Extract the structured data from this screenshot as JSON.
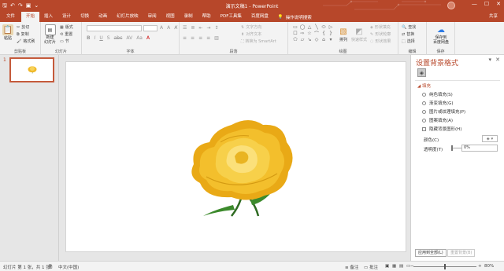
{
  "titlebar": {
    "title": "演示文稿1 - PowerPoint",
    "qat_icons": [
      "save-icon",
      "undo-icon",
      "redo-icon",
      "present-icon",
      "customize-icon"
    ],
    "qat_glyphs": [
      "🖫",
      "↶",
      "↷",
      "▣",
      "⌄"
    ],
    "window_controls": [
      "—",
      "☐",
      "✕"
    ],
    "colors": {
      "accent": "#b7472a"
    }
  },
  "tabs": {
    "items": [
      "文件",
      "开始",
      "插入",
      "设计",
      "切换",
      "动画",
      "幻灯片放映",
      "审阅",
      "视图",
      "录制",
      "帮助",
      "PDF工具集",
      "百度网盘"
    ],
    "active_index": 1,
    "tell_me": "操作说明搜索",
    "share": "共享"
  },
  "ribbon": {
    "clipboard": {
      "paste": "粘贴",
      "cut": "剪切",
      "copy": "复制",
      "format_painter": "格式刷",
      "group": "剪贴板"
    },
    "slides": {
      "new_slide": "新建\n幻灯片",
      "layout": "版式",
      "reset": "重置",
      "section": "节",
      "group": "幻灯片"
    },
    "font": {
      "group": "字体"
    },
    "paragraph": {
      "text_direction": "文字方向",
      "align_text": "对齐文本",
      "smartart": "转换为 SmartArt",
      "group": "段落"
    },
    "drawing": {
      "arrange": "排列",
      "quick_styles": "快速样式",
      "shape_fill": "形状填充",
      "shape_outline": "形状轮廓",
      "shape_effects": "形状效果",
      "group": "绘图",
      "shape_glyphs": [
        "▭",
        "◯",
        "△",
        "╲",
        "⬭",
        "▷",
        "☐",
        "⇨",
        "☆",
        "⌒",
        "{",
        "}",
        "⬠",
        "▱",
        "↘",
        "◇",
        "⌂",
        "▾"
      ]
    },
    "editing": {
      "find": "查找",
      "replace": "替换",
      "select": "选择",
      "group": "编辑"
    },
    "baidu": {
      "save": "保存到\n百度网盘",
      "group": "保存"
    }
  },
  "thumbnails": {
    "slide_number": "1"
  },
  "format_pane": {
    "title": "设置背景格式",
    "section": "填充",
    "options": [
      "纯色填充(S)",
      "渐变填充(G)",
      "图片或纹理填充(P)",
      "图案填充(A)"
    ],
    "hide_graphics": "隐藏背景图形(H)",
    "color_label": "颜色(C)",
    "transparency_label": "透明度(T)",
    "transparency_value": "0%",
    "apply_all": "应用到全部(L)",
    "reset": "重置背景(B)"
  },
  "statusbar": {
    "slide_info": "幻灯片 第 1 张，共 1 张",
    "language": "中文(中国)",
    "notes": "备注",
    "comments": "批注",
    "zoom": "80%"
  }
}
